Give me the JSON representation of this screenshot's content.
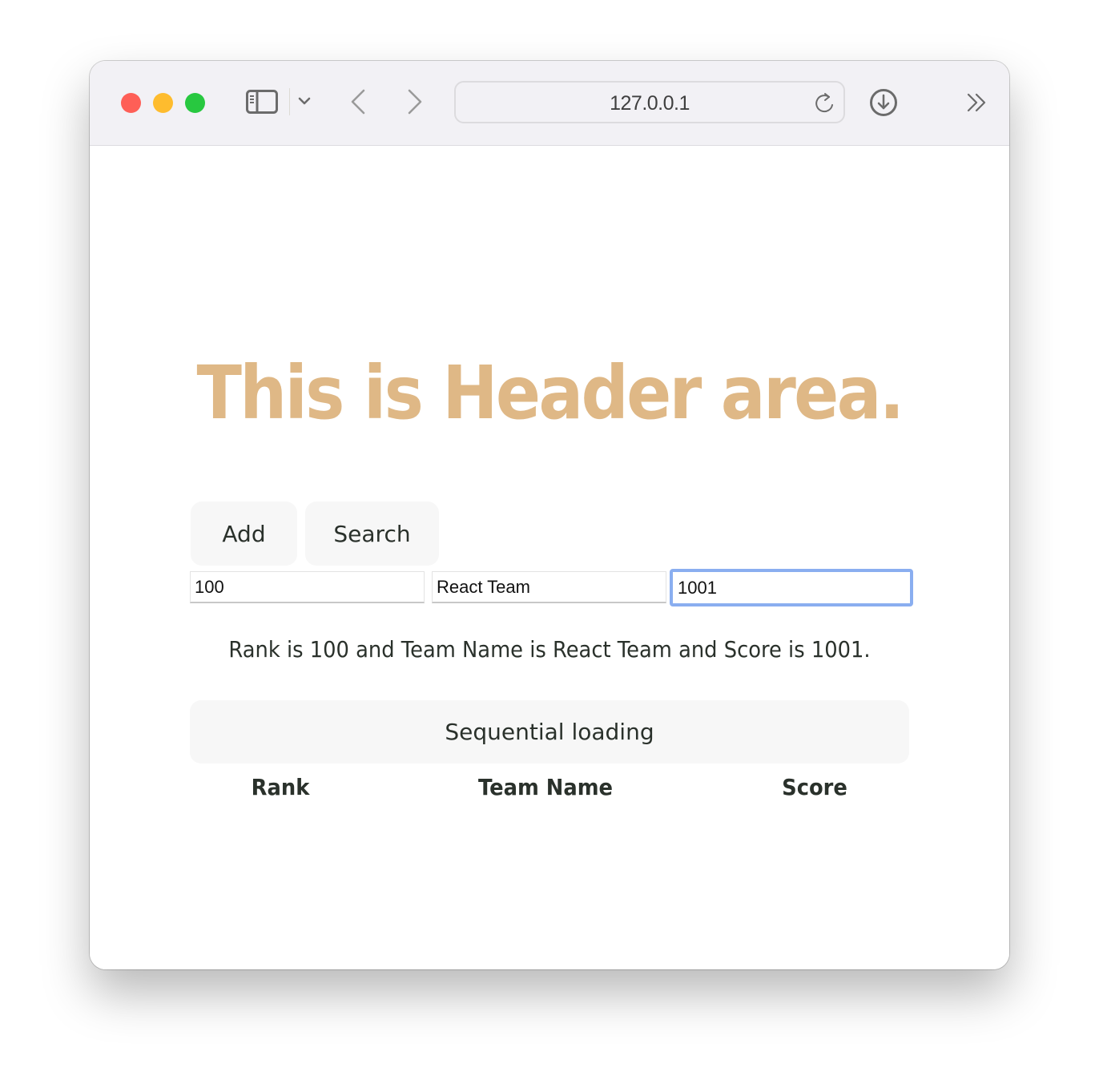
{
  "browser": {
    "address": "127.0.0.1",
    "icons": {
      "sidebar": "sidebar-icon",
      "chevron": "chevron-down-icon",
      "back": "chevron-left-icon",
      "forward": "chevron-right-icon",
      "reload": "reload-icon",
      "download": "download-icon",
      "more": "double-chevron-right-icon"
    }
  },
  "page": {
    "header_title": "This is Header area.",
    "buttons": {
      "add": "Add",
      "search": "Search"
    },
    "inputs": {
      "rank": "100",
      "team_name": "React Team",
      "score": "1001"
    },
    "summary": "Rank is 100 and Team Name is React Team and Score is 1001.",
    "loading_button": "Sequential loading",
    "table": {
      "columns": [
        "Rank",
        "Team Name",
        "Score"
      ],
      "rows": []
    },
    "colors": {
      "header": "#dfb886",
      "focus_ring": "#8aaef0",
      "button_bg": "#f7f7f7",
      "text": "#2a312b"
    }
  }
}
